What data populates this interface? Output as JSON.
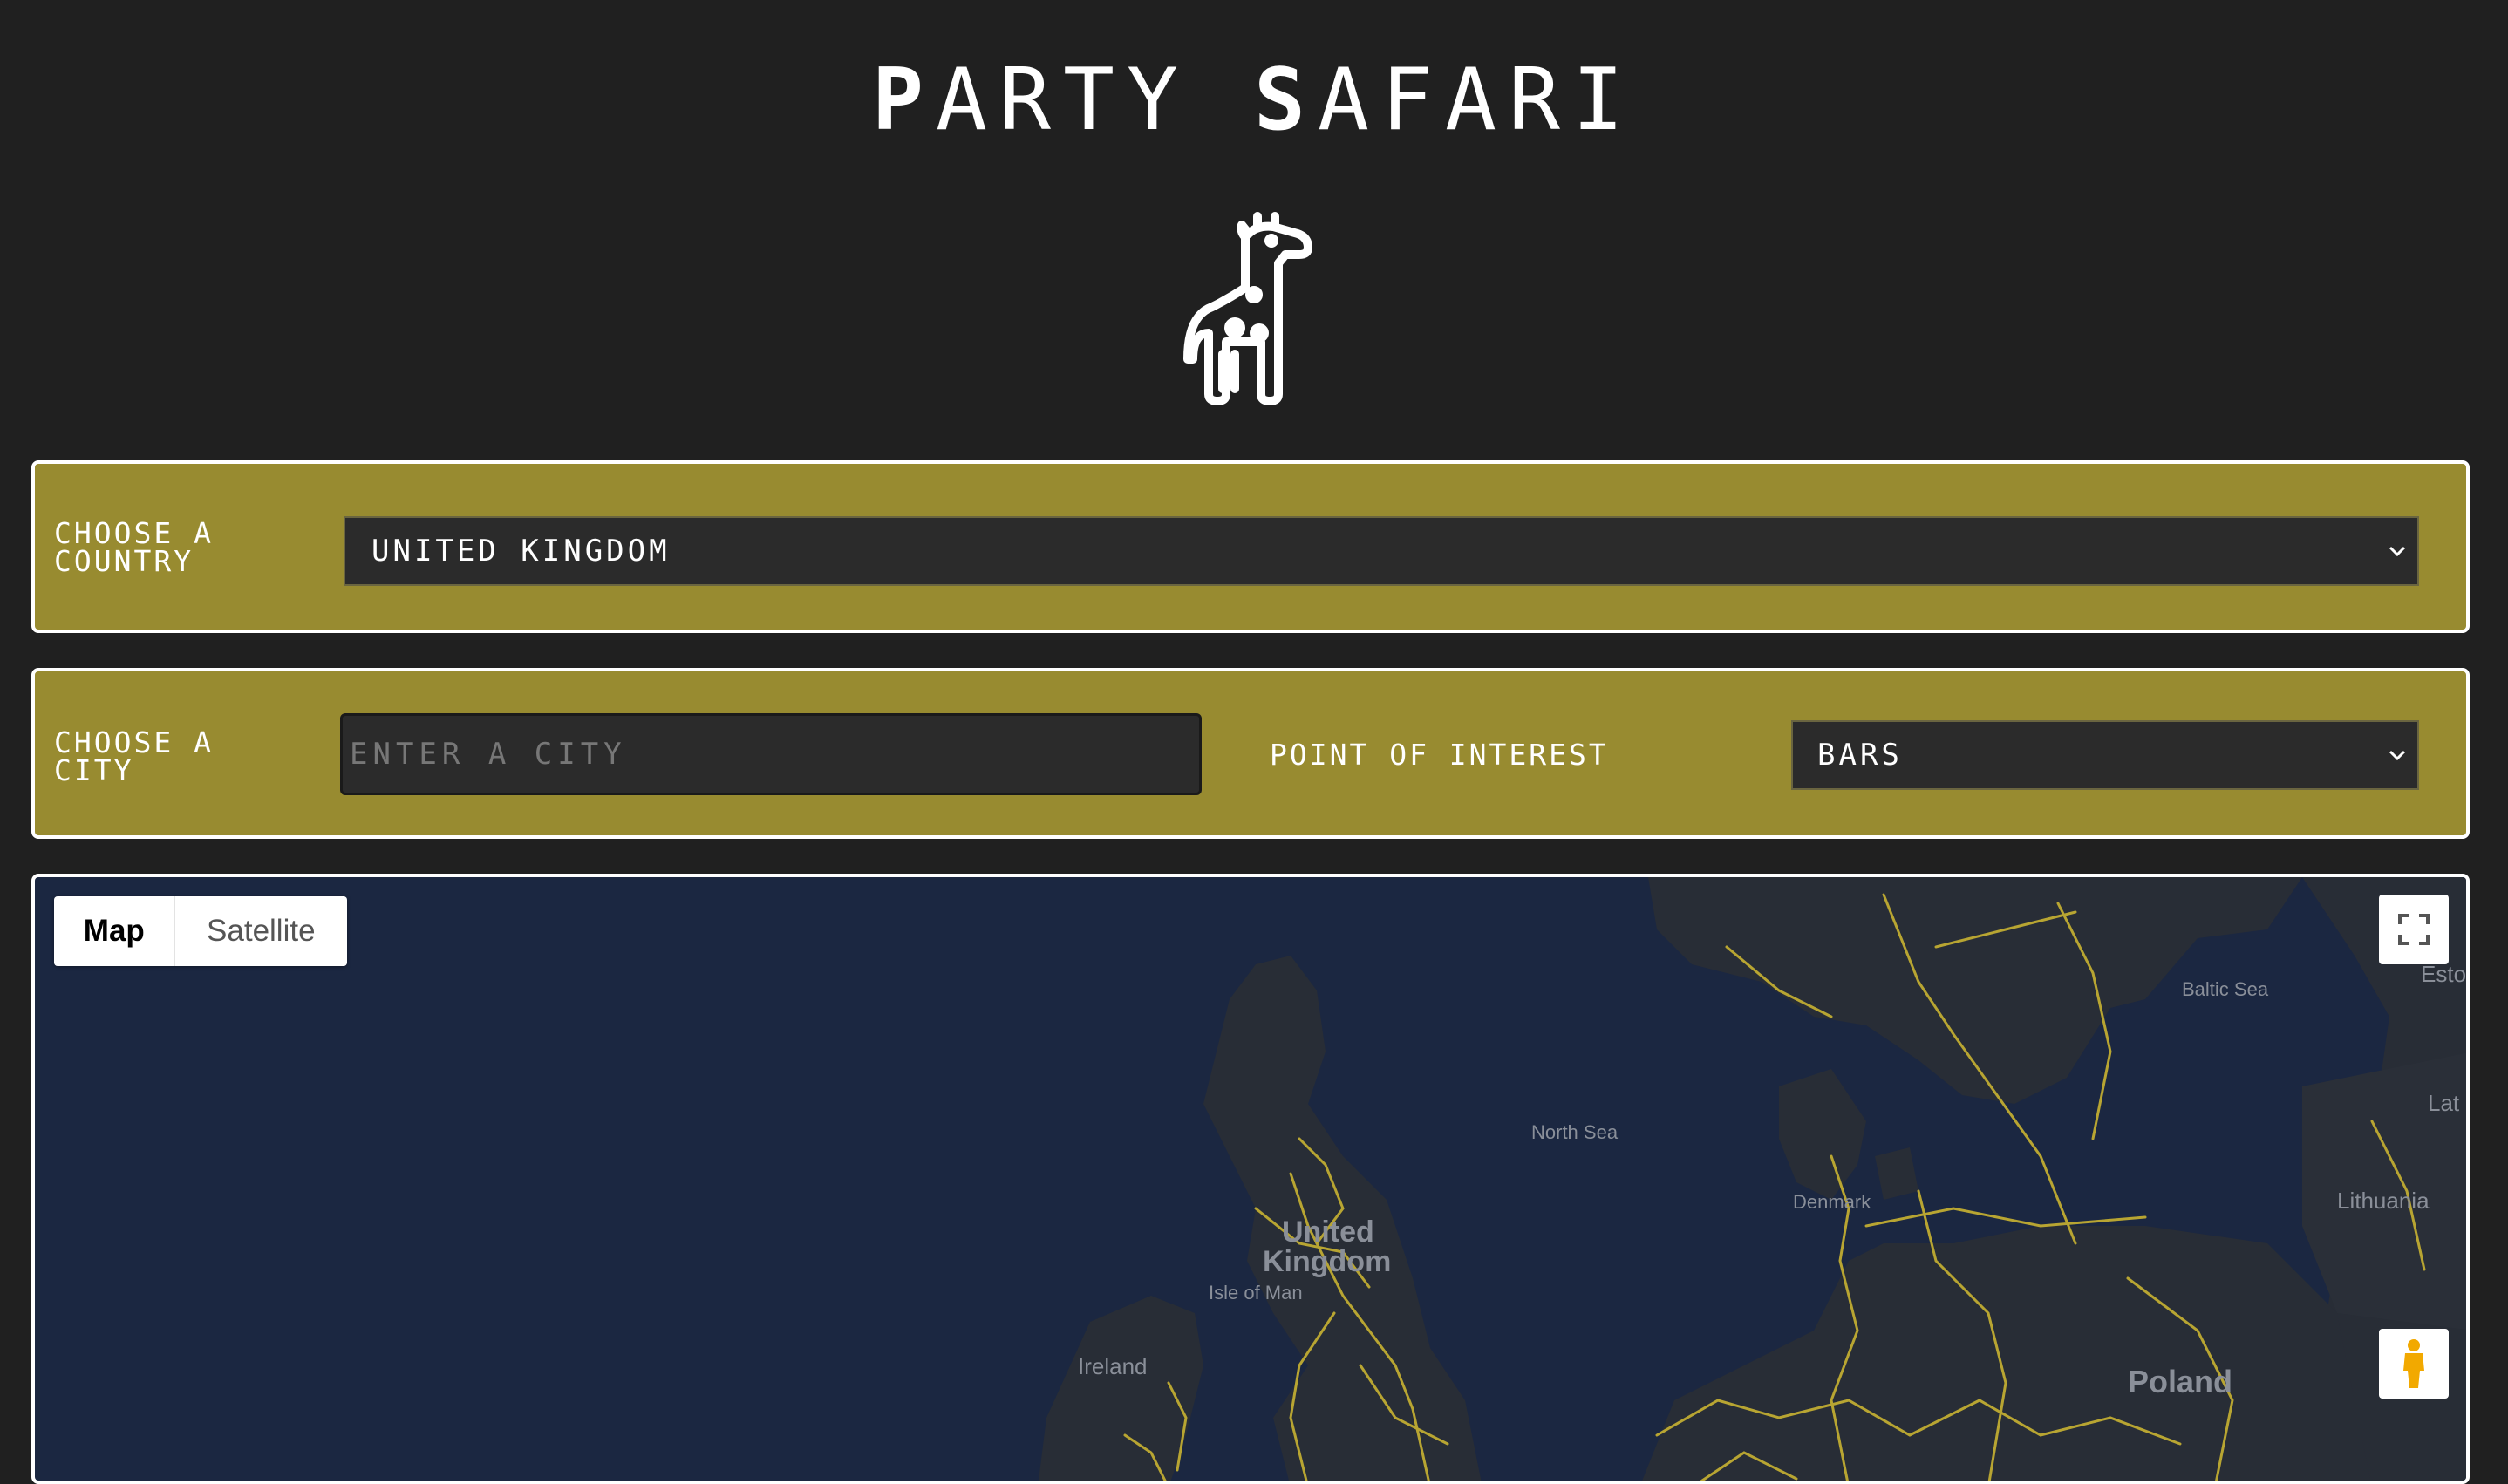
{
  "header": {
    "title_p": "P",
    "title_rest1": "ARTY ",
    "title_s": "S",
    "title_rest2": "AFARI"
  },
  "logo": {
    "icon": "giraffe-icon"
  },
  "country_panel": {
    "label": "Choose a\nCountry",
    "selected": "United Kingdom"
  },
  "city_panel": {
    "label": "Choose a\ncity",
    "city_placeholder": "Enter a city",
    "poi_label": "Point of Interest",
    "poi_selected": "Bars"
  },
  "map": {
    "type_buttons": [
      "Map",
      "Satellite"
    ],
    "labels": {
      "baltic_sea": "Baltic Sea",
      "esto": "Esto",
      "north_sea": "North Sea",
      "lat": "Lat",
      "denmark": "Denmark",
      "lithuania": "Lithuania",
      "united": "United",
      "kingdom": "Kingdom",
      "isle_of_man": "Isle of Man",
      "ireland": "Ireland",
      "poland": "Poland"
    },
    "colors": {
      "water": "#1b2741",
      "land": "#282d36",
      "roads": "#b8a532"
    }
  },
  "colors": {
    "background": "#202020",
    "panel": "#988b30"
  }
}
